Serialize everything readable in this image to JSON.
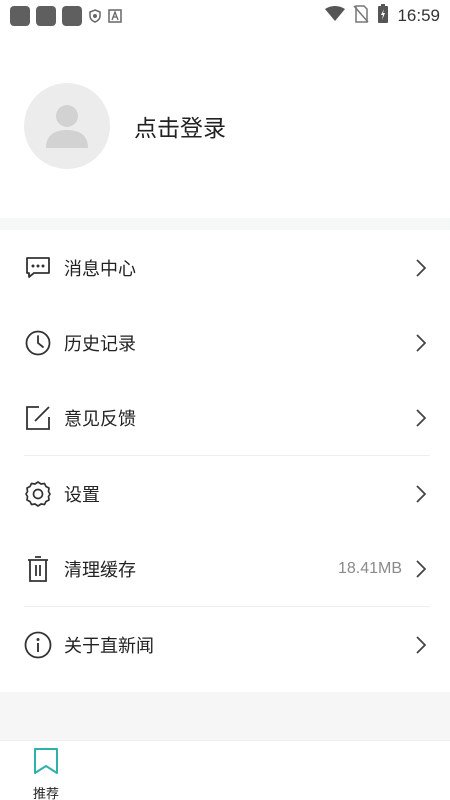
{
  "status_bar": {
    "time": "16:59",
    "icons": [
      "app-icon",
      "app-icon",
      "app-icon",
      "shield-icon",
      "a-box-icon",
      "wifi-icon",
      "no-sim-icon",
      "battery-charging-icon"
    ]
  },
  "profile": {
    "login_label": "点击登录",
    "avatar_icon": "user-avatar-icon"
  },
  "menu": {
    "items": [
      {
        "label": "消息中心",
        "icon": "message-icon",
        "value": ""
      },
      {
        "label": "历史记录",
        "icon": "clock-icon",
        "value": ""
      },
      {
        "label": "意见反馈",
        "icon": "edit-icon",
        "value": ""
      },
      {
        "label": "设置",
        "icon": "gear-icon",
        "value": ""
      },
      {
        "label": "清理缓存",
        "icon": "trash-icon",
        "value": "18.41MB"
      },
      {
        "label": "关于直新闻",
        "icon": "info-icon",
        "value": ""
      }
    ]
  },
  "tab_bar": {
    "tabs": [
      {
        "label": "推荐",
        "icon": "bookmark-icon",
        "active_color": "#2fb0a8"
      }
    ]
  },
  "colors": {
    "accent": "#2fb0a8",
    "text": "#222222",
    "muted": "#8a8a8a",
    "band": "#f4f8f7"
  }
}
